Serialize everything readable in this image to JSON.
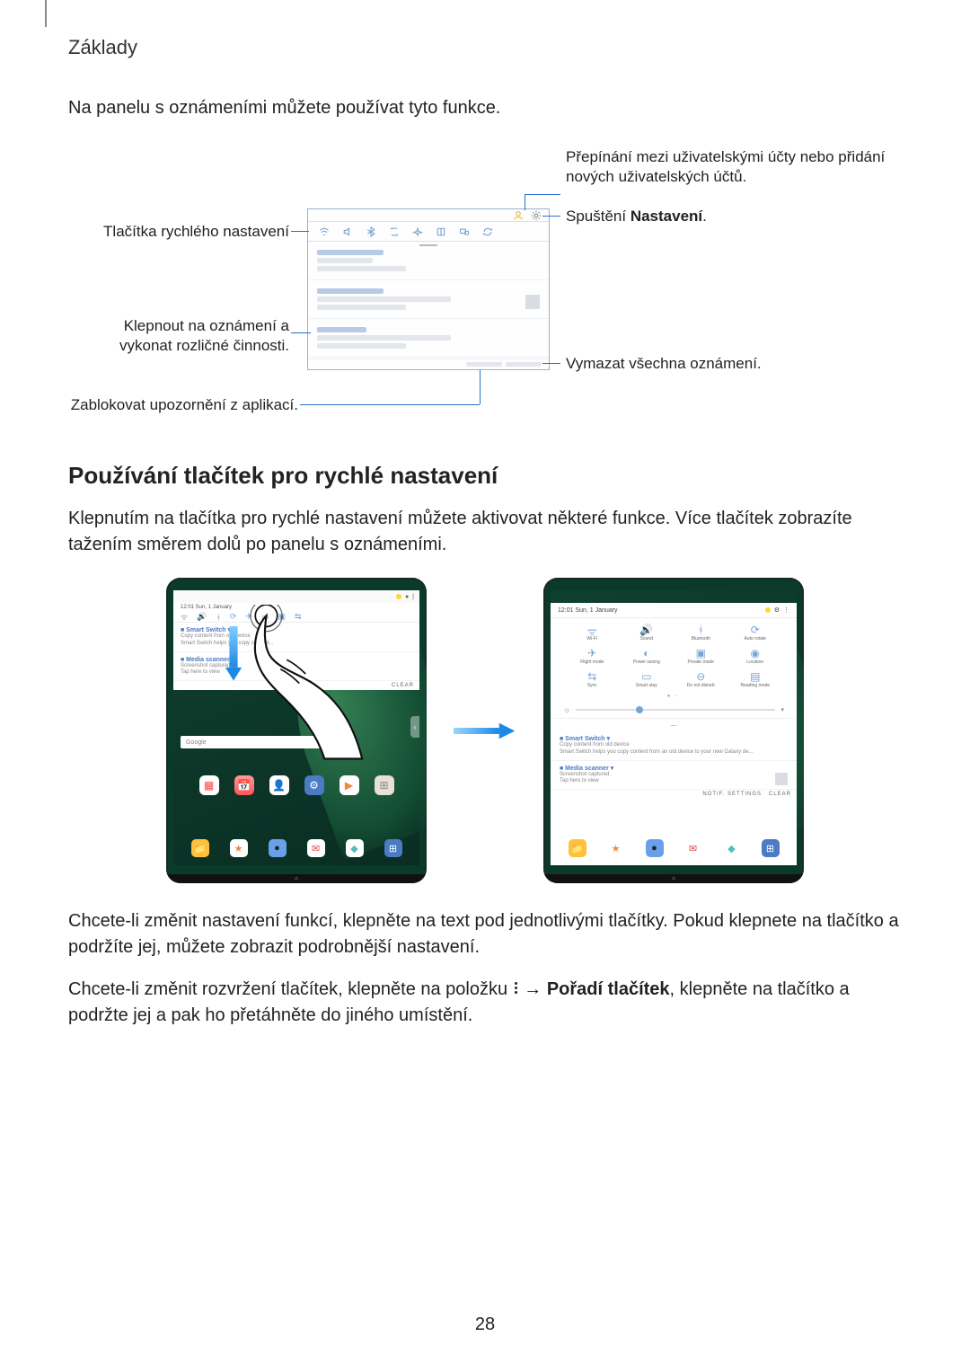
{
  "chapter": "Základy",
  "intro": "Na panelu s oznámeními můžete používat tyto funkce.",
  "callouts": {
    "quick_settings": "Tlačítka rychlého nastavení",
    "tap_notification": "Klepnout na oznámení a vykonat rozličné činnosti.",
    "block_app": "Zablokovat upozornění z aplikací.",
    "switch_user": "Přepínání mezi uživatelskými účty nebo přidání nových uživatelských účtů.",
    "launch_settings_pre": "Spuštění ",
    "launch_settings_bold": "Nastavení",
    "launch_settings_post": ".",
    "clear_all": "Vymazat všechna oznámení."
  },
  "h2": "Používání tlačítek pro rychlé nastavení",
  "para1": "Klepnutím na tlačítka pro rychlé nastavení můžete aktivovat některé funkce. Více tlačítek zobrazíte tažením směrem dolů po panelu s oznámeními.",
  "para2": "Chcete-li změnit nastavení funkcí, klepněte na text pod jednotlivými tlačítky. Pokud klepnete na tlačítko a podržíte jej, můžete zobrazit podrobnější nastavení.",
  "para3_a": "Chcete-li změnit rozvržení tlačítek, klepněte na položku ",
  "para3_b": " → ",
  "para3_bold": "Pořadí tlačítek",
  "para3_c": ", klepněte na tlačítko a podržte jej a pak ho přetáhněte do jiného umístění.",
  "page_number": "28",
  "screenshots": {
    "date": "12:01  Sun, 1 January",
    "search": "Google",
    "qs_labels": [
      "Wi-Fi",
      "Sound",
      "Bluetooth",
      "Auto rotate",
      "Flight mode",
      "Power saving",
      "Private mode",
      "Location",
      "Sync",
      "Smart stay",
      "Do not disturb",
      "Reading mode"
    ]
  }
}
